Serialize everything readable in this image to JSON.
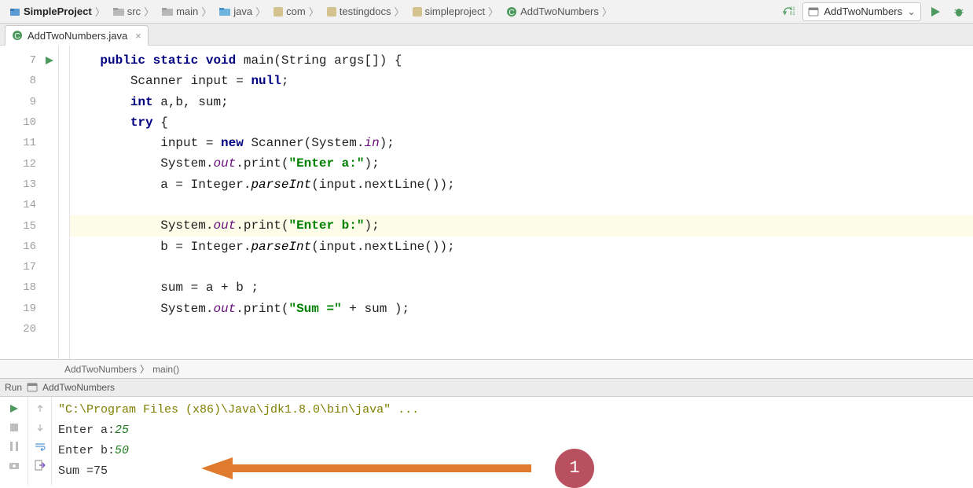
{
  "breadcrumb": [
    {
      "label": "SimpleProject",
      "bold": true,
      "icon": "project"
    },
    {
      "label": "src",
      "bold": false,
      "icon": "folder"
    },
    {
      "label": "main",
      "bold": false,
      "icon": "folder"
    },
    {
      "label": "java",
      "bold": false,
      "icon": "folder-src"
    },
    {
      "label": "com",
      "bold": false,
      "icon": "package"
    },
    {
      "label": "testingdocs",
      "bold": false,
      "icon": "package"
    },
    {
      "label": "simpleproject",
      "bold": false,
      "icon": "package"
    },
    {
      "label": "AddTwoNumbers",
      "bold": false,
      "icon": "class"
    }
  ],
  "run_config_label": "AddTwoNumbers",
  "tab": {
    "label": "AddTwoNumbers.java"
  },
  "gutter_lines": [
    "7",
    "8",
    "9",
    "10",
    "11",
    "12",
    "13",
    "14",
    "15",
    "16",
    "17",
    "18",
    "19",
    "20"
  ],
  "highlighted_line_index": 8,
  "code_crumb": {
    "class": "AddTwoNumbers",
    "method": "main()"
  },
  "run_header": {
    "label": "Run",
    "target": "AddTwoNumbers"
  },
  "console": {
    "cmd": "\"C:\\Program Files (x86)\\Java\\jdk1.8.0\\bin\\java\" ...",
    "rows": [
      {
        "prompt": "Enter a:",
        "input": "25"
      },
      {
        "prompt": "Enter b:",
        "input": "50"
      }
    ],
    "result": "Sum =75"
  },
  "annotation_number": "1",
  "code_tokens": {
    "public": "public",
    "static": "static",
    "void": "void",
    "main": "main",
    "sig": "(String args[]) {",
    "l8a": "Scanner input = ",
    "null": "null",
    "semi": ";",
    "int": "int",
    "l9b": " a,b, sum;",
    "try": "try",
    "l10b": " {",
    "l11a": "input = ",
    "new": "new",
    "l11b": " Scanner(System.",
    "in": "in",
    "l11c": ");",
    "l12a": "System.",
    "out": "out",
    "l12b": ".print(",
    "l12s": "\"Enter a:\"",
    "l12c": ");",
    "l13a": "a = Integer.",
    "parseInt": "parseInt",
    "l13b": "(input.nextLine());",
    "l15a": "System.",
    "l15b": ".print(",
    "l15s": "\"Enter b:\"",
    "l15c": ");",
    "l16a": "b = Integer.",
    "l16b": "(input.nextLine());",
    "l18": "sum = a + b ;",
    "l19a": "System.",
    "l19b": ".print(",
    "l19s": "\"Sum =\"",
    "l19c": " + sum );"
  }
}
